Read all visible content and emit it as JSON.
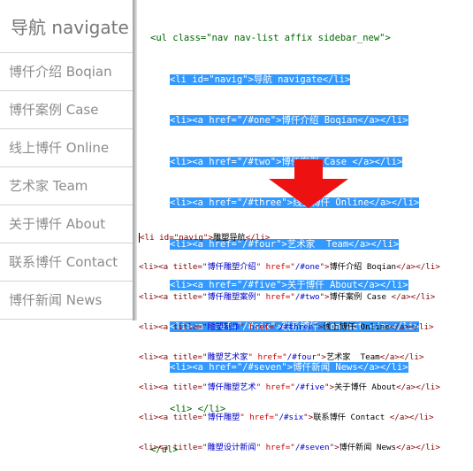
{
  "sidebar": {
    "title": "导航 navigate",
    "items": [
      {
        "label": "博仟介绍 Boqian"
      },
      {
        "label": "博仟案例 Case"
      },
      {
        "label": "线上博仟 Online"
      },
      {
        "label": "艺术家 Team"
      },
      {
        "label": "关于博仟 About"
      },
      {
        "label": "联系博仟 Contact"
      },
      {
        "label": "博仟新闻 News"
      }
    ]
  },
  "code_top": {
    "open_ul": "<ul class=\"nav nav-list affix sidebar_new\">",
    "selected_lines": [
      "<li id=\"navig\">导航 navigate</li>",
      "<li><a href=\"/#one\">博仟介绍 Boqian</a></li>",
      "<li><a href=\"/#two\">博仟案例 Case </a></li>",
      "<li><a href=\"/#three\">线上博仟 Online</a></li>",
      "<li><a href=\"/#four\">艺术家  Team</a></li>",
      "<li><a href=\"/#five\">关于博仟 About</a></li>",
      "<li><a href=\"/#six\">联系博仟 Contact </a></li>",
      "<li><a href=\"/#seven\">博仟新闻 News</a></li>"
    ],
    "empty_li": "<li> </li>",
    "close_ul": "</ul>"
  },
  "code_bottom": {
    "lines": [
      {
        "pre": "<li id=\"navig\">",
        "title": "",
        "href": "",
        "text": "雕塑导航",
        "post": "</li>"
      },
      {
        "pre": "<li><a title=\"",
        "title": "博仟雕塑介绍",
        "mid": "\" href=\"",
        "href": "/#one",
        "end": "\">",
        "text": "博仟介绍 Boqian",
        "post": "</a></li>"
      },
      {
        "pre": "<li><a title=\"",
        "title": "博仟雕塑案例",
        "mid": "\" href=\"",
        "href": "/#two",
        "end": "\">",
        "text": "博仟案例 Case ",
        "post": "</a></li>"
      },
      {
        "pre": "<li><a title=\"",
        "title": "雕塑制作",
        "mid": "\" href=\"",
        "href": "/#three",
        "end": "\">",
        "text": "线上博仟 Online",
        "post": "</a></li>"
      },
      {
        "pre": "<li><a title=\"",
        "title": "雕塑艺术家",
        "mid": "\" href=\"",
        "href": "/#four",
        "end": "\">",
        "text": "艺术家  Team",
        "post": "</a></li>"
      },
      {
        "pre": "<li><a title=\"",
        "title": "博仟雕塑艺术",
        "mid": "\" href=\"",
        "href": "/#five",
        "end": "\">",
        "text": "关于博仟 About",
        "post": "</a></li>"
      },
      {
        "pre": "<li><a title=\"",
        "title": "博仟雕塑",
        "mid": "\" href=\"",
        "href": "/#six",
        "end": "\">",
        "text": "联系博仟 Contact ",
        "post": "</a></li>"
      },
      {
        "pre": "<li><a title=\"",
        "title": "雕塑设计新闻",
        "mid": "\" href=\"",
        "href": "/#seven",
        "end": "\">",
        "text": "博仟新闻 News",
        "post": "</a></li>"
      }
    ]
  },
  "colors": {
    "selection": "#3399ff",
    "arrow": "#ee1111",
    "sidebar_text": "#8c8c8c"
  }
}
